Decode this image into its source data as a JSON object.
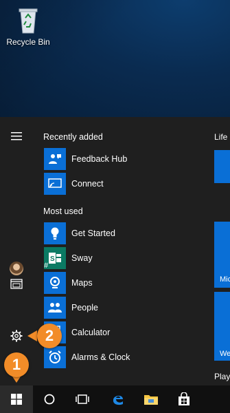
{
  "desktop": {
    "recycle_bin_label": "Recycle Bin"
  },
  "start_menu": {
    "recently_added_heading": "Recently added",
    "recently_added": [
      {
        "label": "Feedback Hub",
        "icon": "feedback-hub-icon"
      },
      {
        "label": "Connect",
        "icon": "connect-icon"
      }
    ],
    "most_used_heading": "Most used",
    "most_used": [
      {
        "label": "Get Started",
        "icon": "lightbulb-icon"
      },
      {
        "label": "Sway",
        "icon": "sway-icon"
      },
      {
        "label": "Maps",
        "icon": "maps-icon"
      },
      {
        "label": "People",
        "icon": "people-icon"
      },
      {
        "label": "Calculator",
        "icon": "calculator-icon"
      },
      {
        "label": "Alarms & Clock",
        "icon": "alarm-clock-icon"
      }
    ],
    "alpha_heading": "#",
    "tiles": {
      "group_heading": "Life a",
      "tile2_text": "Mic",
      "tile3_text": "We",
      "play_heading": "Play"
    }
  },
  "callouts": {
    "one": "1",
    "two": "2"
  },
  "colors": {
    "accent": "#0a6fd6",
    "callout": "#f28c28",
    "menu_bg": "#1f1f1f",
    "taskbar_bg": "#101010"
  }
}
